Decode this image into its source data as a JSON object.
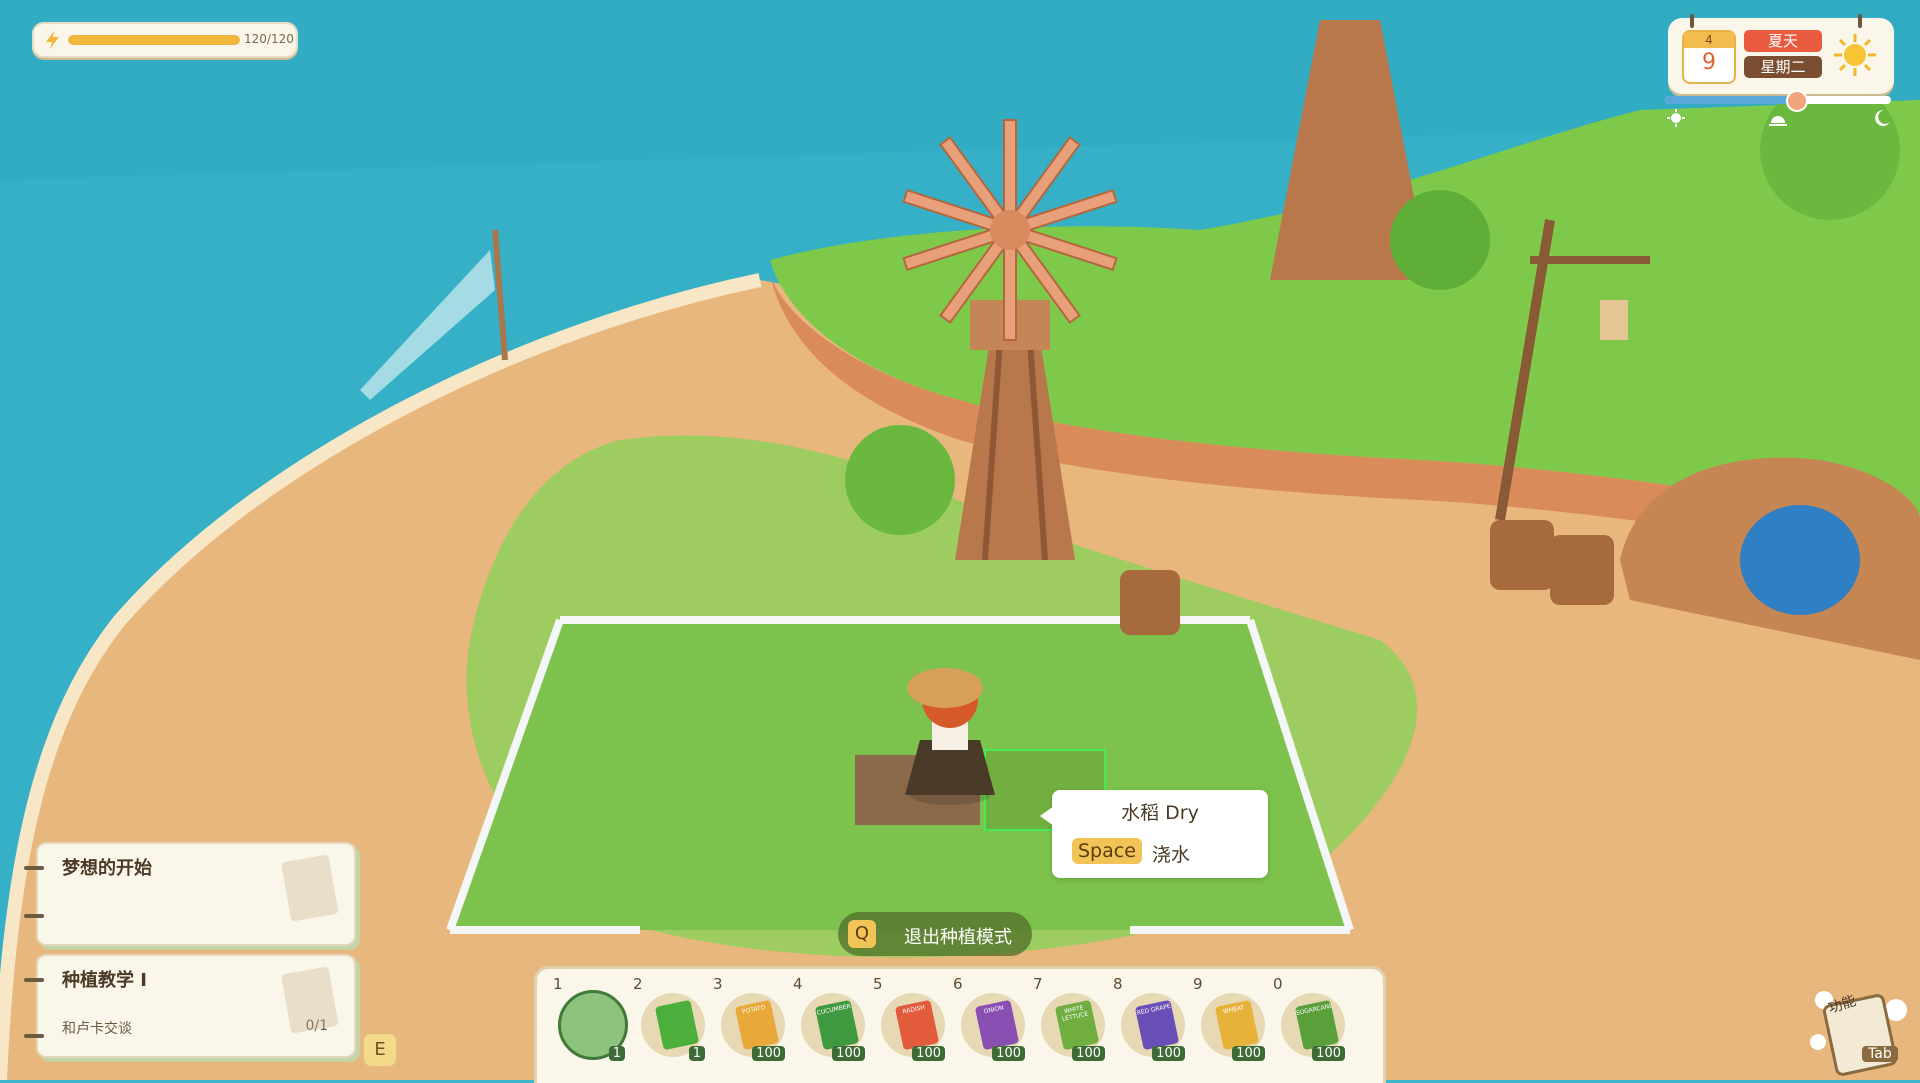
{
  "energy": {
    "value_text": "120/120",
    "fraction": 1.0,
    "icon": "lightning-icon"
  },
  "calendar": {
    "month": "4",
    "day": "9",
    "season": "夏天",
    "weekday": "星期二",
    "weather_icon": "sun-icon"
  },
  "time_of_day": {
    "fraction": 0.58,
    "icons": [
      "sunrise-icon",
      "noon-icon",
      "moon-icon"
    ]
  },
  "quests": [
    {
      "title": "梦想的开始",
      "subtitle": "",
      "progress": ""
    },
    {
      "title": "种植教学 I",
      "subtitle": "和卢卡交谈",
      "progress": "0/1"
    }
  ],
  "quest_hotkey": "E",
  "tooltip": {
    "crop_name": "水稻 Dry",
    "key": "Space",
    "action": "浇水"
  },
  "exit_hint": {
    "key": "Q",
    "label": "退出种植模式"
  },
  "hotbar": {
    "selected": 0,
    "slots": [
      {
        "num": "1",
        "item": "hoe",
        "qty": "1",
        "color": "#8cc27b"
      },
      {
        "num": "2",
        "item": "watering-can",
        "qty": "1",
        "color": "#4caf3c"
      },
      {
        "num": "3",
        "item": "potato-seeds",
        "label": "POTATO",
        "qty": "100",
        "color": "#e8a93a"
      },
      {
        "num": "4",
        "item": "cucumber-seeds",
        "label": "CUCUMBER",
        "qty": "100",
        "color": "#3f9a3f"
      },
      {
        "num": "5",
        "item": "radish-seeds",
        "label": "RADISH",
        "qty": "100",
        "color": "#e25b3a"
      },
      {
        "num": "6",
        "item": "onion-seeds",
        "label": "ONION",
        "qty": "100",
        "color": "#8a4fb2"
      },
      {
        "num": "7",
        "item": "white-lettuce-seeds",
        "label": "WHITE LETTUCE",
        "qty": "100",
        "color": "#6fae3f"
      },
      {
        "num": "8",
        "item": "red-grape-seeds",
        "label": "RED GRAPE",
        "qty": "100",
        "color": "#6b4fb8"
      },
      {
        "num": "9",
        "item": "wheat-seeds",
        "label": "WHEAT",
        "qty": "100",
        "color": "#e6b23a"
      },
      {
        "num": "0",
        "item": "sugarcane-seeds",
        "label": "SUGARCANE",
        "qty": "100",
        "color": "#5aa03a"
      }
    ]
  },
  "function_menu": {
    "label": "功能",
    "key": "Tab"
  }
}
